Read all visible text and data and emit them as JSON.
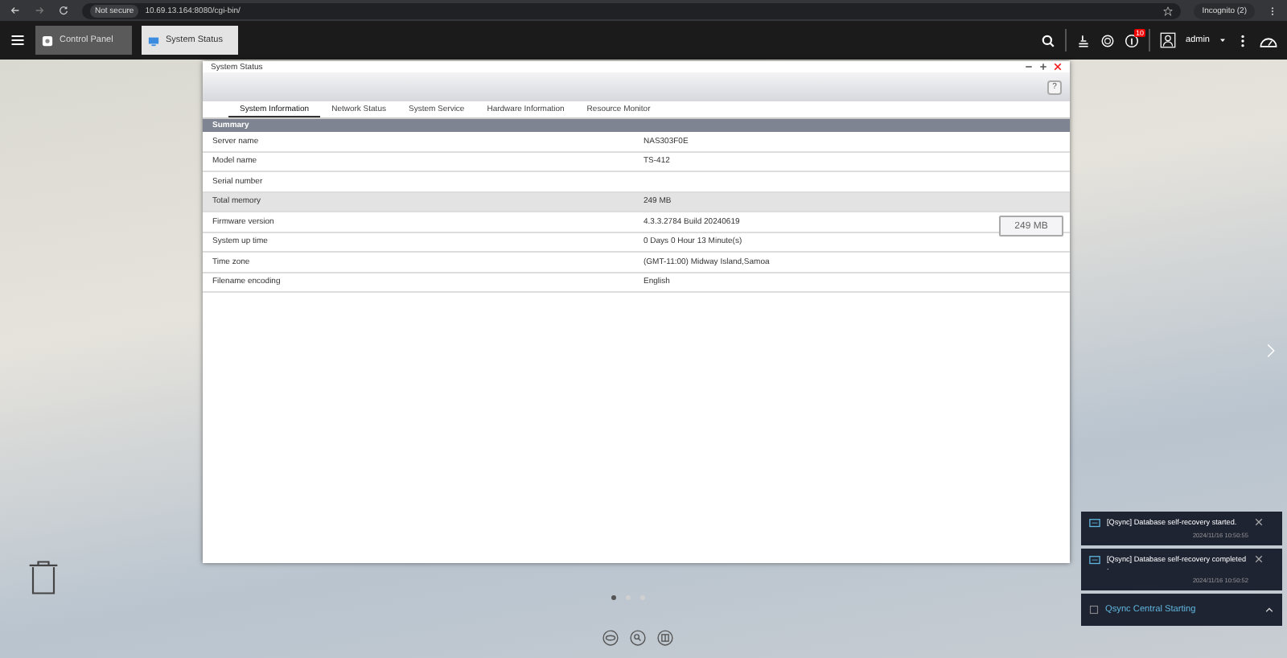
{
  "browser": {
    "security": "Not secure",
    "url": "10.69.13.164:8080/cgi-bin/",
    "profile": "Incognito (2)"
  },
  "taskbar": {
    "tabs": [
      {
        "label": "Control Panel",
        "selected": false
      },
      {
        "label": "System Status",
        "selected": true
      }
    ],
    "badge": "10",
    "user": "admin"
  },
  "window": {
    "title": "System Status",
    "tabs": [
      {
        "label": "System Information",
        "selected": true
      },
      {
        "label": "Network Status",
        "selected": false
      },
      {
        "label": "System Service",
        "selected": false
      },
      {
        "label": "Hardware Information",
        "selected": false
      },
      {
        "label": "Resource Monitor",
        "selected": false
      }
    ],
    "section": "Summary",
    "rows": [
      {
        "label": "Server name",
        "value": "NAS303F0E",
        "highlighted": false
      },
      {
        "label": "Model name",
        "value": "TS-412",
        "highlighted": false
      },
      {
        "label": "Serial number",
        "highlighted": false
      },
      {
        "label": "Total memory",
        "value": "249 MB",
        "highlighted": true
      },
      {
        "label": "Firmware version",
        "value": "4.3.3.2784 Build 20240619",
        "highlighted": false
      },
      {
        "label": "System up time",
        "value": "0 Days 0 Hour 13 Minute(s)",
        "highlighted": false
      },
      {
        "label": "Time zone",
        "value": "(GMT-11:00) Midway Island,Samoa",
        "highlighted": false
      },
      {
        "label": "Filename encoding",
        "value": "English",
        "highlighted": false
      }
    ],
    "tooltip": "249 MB",
    "help": "?"
  },
  "desktop": {
    "pages": [
      {
        "selected": true
      },
      {
        "selected": false
      },
      {
        "selected": false
      }
    ]
  },
  "notifications": [
    {
      "kind": "message",
      "text": "[Qsync] Database self-recovery started.",
      "time": "2024/11/16 10:50:55"
    },
    {
      "kind": "message",
      "text": "[Qsync] Database self-recovery completed .",
      "time": "2024/11/16 10:50:52"
    },
    {
      "kind": "progress",
      "text": "Qsync Central Starting"
    }
  ]
}
